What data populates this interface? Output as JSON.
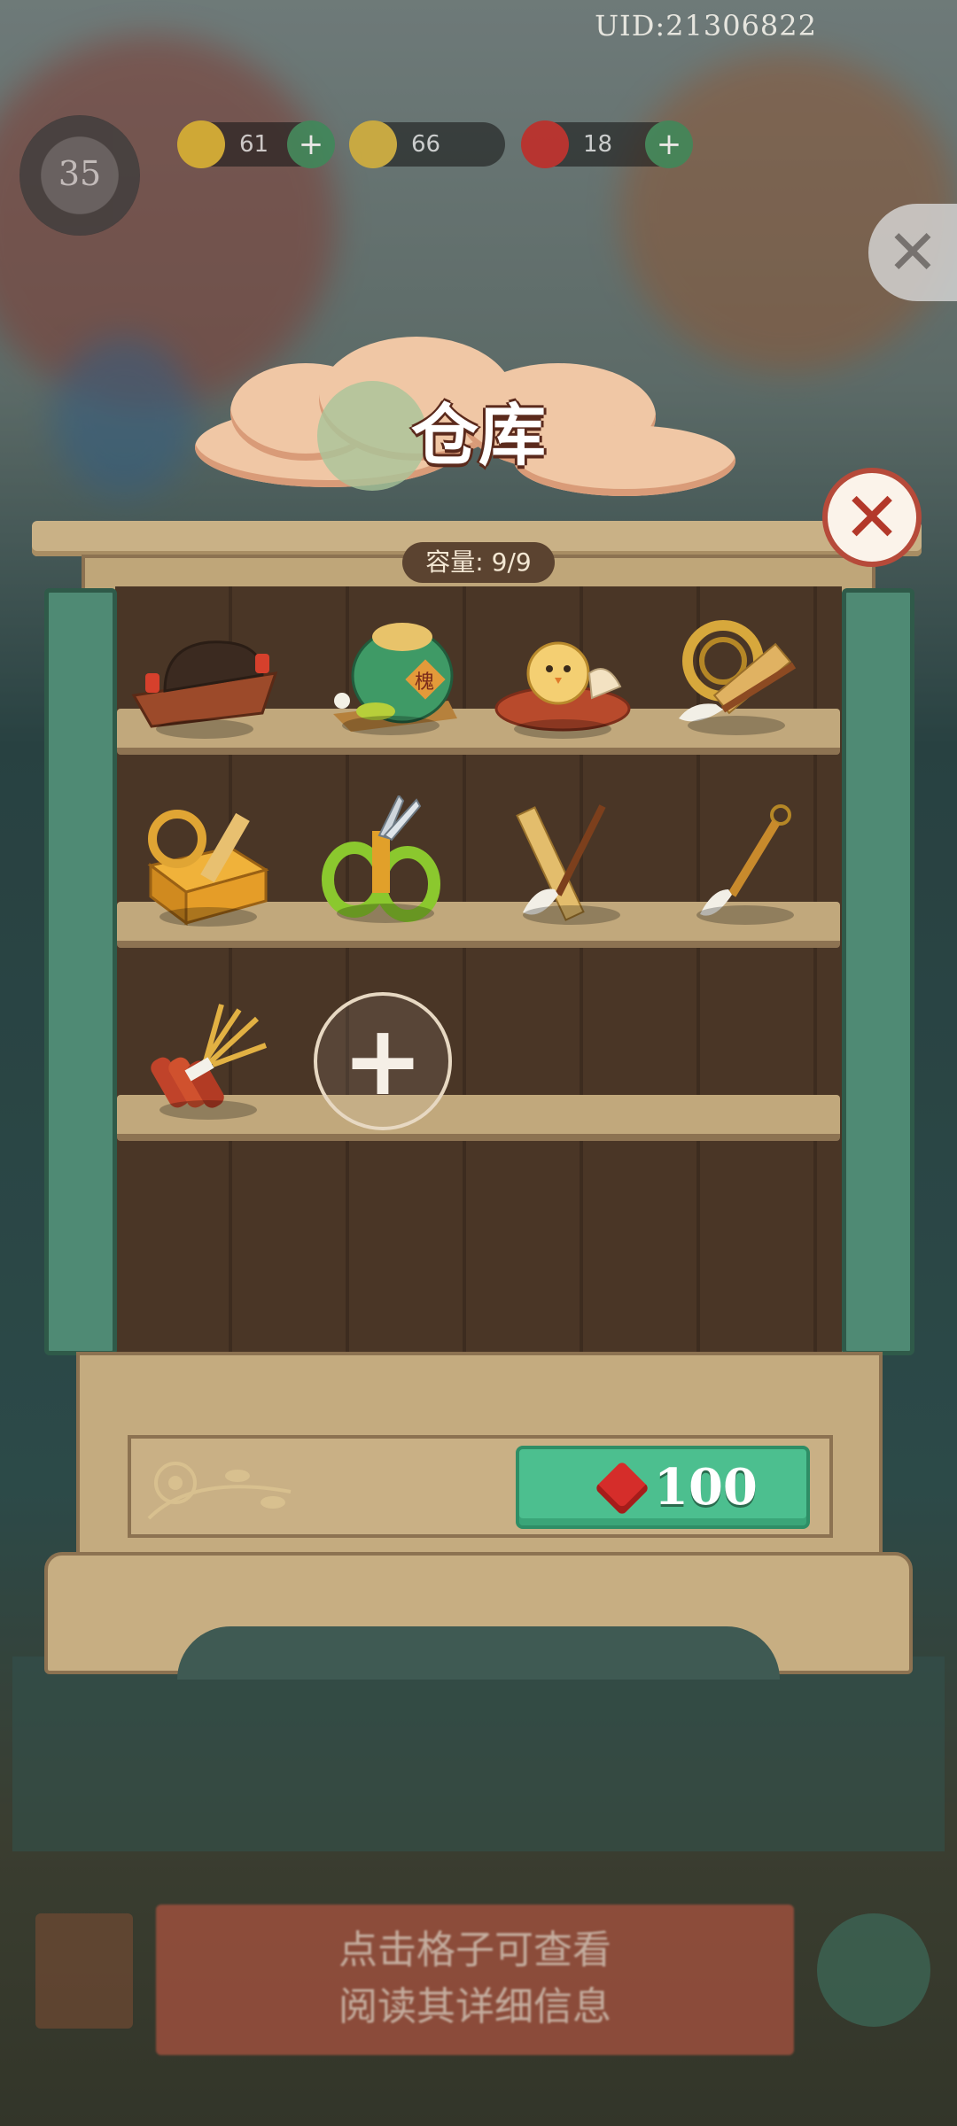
{
  "uid": "UID:21306822",
  "hud": {
    "level": "35",
    "energy": "61",
    "coins": "66",
    "gems": "18",
    "plus": "+"
  },
  "title": "仓库",
  "capacity": "容量: 9/9",
  "close_label": "✕",
  "items": [
    {
      "name": "boat",
      "icon": "lantern-boat-icon"
    },
    {
      "name": "wine-jar",
      "icon": "wine-jar-icon",
      "jar_label": "槐"
    },
    {
      "name": "chick-nest",
      "icon": "chick-nest-icon"
    },
    {
      "name": "rope-ruler-brush",
      "icon": "rope-ruler-brush-icon"
    },
    {
      "name": "tool-box",
      "icon": "toolbox-icon"
    },
    {
      "name": "pruning-shears",
      "icon": "shears-icon"
    },
    {
      "name": "ruler-brush",
      "icon": "ruler-brush-icon"
    },
    {
      "name": "brush",
      "icon": "brush-icon"
    },
    {
      "name": "firewood-bundle",
      "icon": "firewood-icon"
    }
  ],
  "add_slot_label": "+",
  "buy": {
    "price": "100",
    "currency_icon": "ruby-gem-icon"
  },
  "bottom_hint": [
    "点击格子可查看",
    "阅读其详细信息"
  ],
  "colors": {
    "accent_green": "#4cbf8f",
    "close_red": "#b3382a",
    "door_green": "#4f8a74"
  }
}
